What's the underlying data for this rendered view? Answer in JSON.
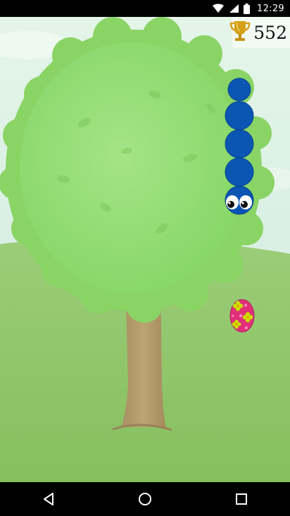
{
  "status_bar": {
    "time": "12:29",
    "icons": [
      "wifi-icon",
      "signal-icon",
      "battery-icon"
    ]
  },
  "game": {
    "score": "552",
    "score_icon": "trophy-icon",
    "player": "snake",
    "snake_segments": 4,
    "pickup": "easter-egg",
    "colors": {
      "snake": "#0b56b3",
      "egg": "#e0307a",
      "egg_flowers": "#c8e000",
      "trophy": "#d4a017",
      "tree_foliage": "#8fdc6c",
      "trunk": "#b59a6a",
      "ground": "#8fc868",
      "sky": "#d8f0e0"
    }
  },
  "nav": {
    "icons": [
      "back-icon",
      "home-icon",
      "recents-icon"
    ]
  }
}
